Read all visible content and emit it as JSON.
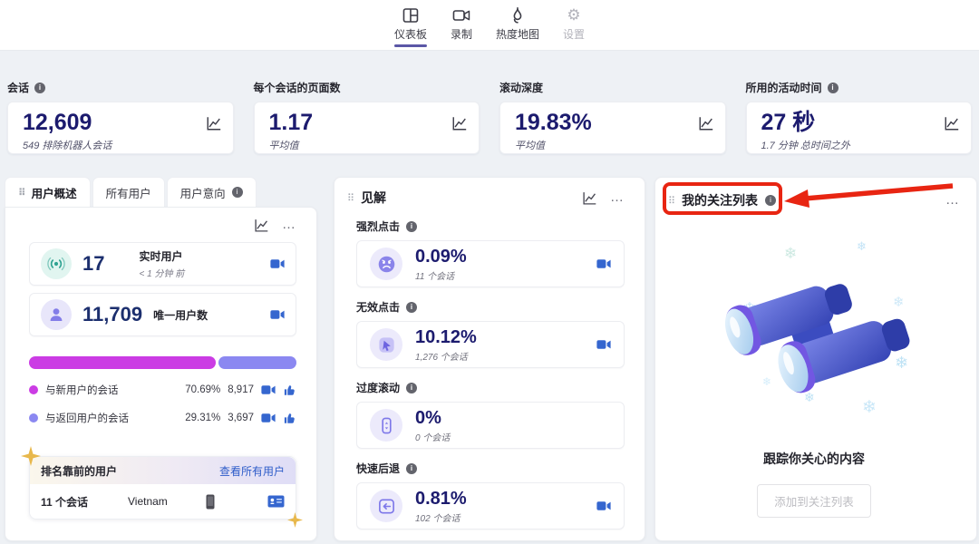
{
  "nav": {
    "items": [
      {
        "label": "仪表板",
        "icon": "dashboard-icon",
        "active": true
      },
      {
        "label": "录制",
        "icon": "recordings-icon",
        "active": false
      },
      {
        "label": "热度地图",
        "icon": "heatmap-icon",
        "active": false
      },
      {
        "label": "设置",
        "icon": "settings-icon",
        "active": false
      }
    ]
  },
  "metrics": {
    "cards": [
      {
        "label": "会话",
        "value": "12,609",
        "subtitle": "549 排除机器人会话"
      },
      {
        "label": "每个会话的页面数",
        "value": "1.17",
        "subtitle": "平均值"
      },
      {
        "label": "滚动深度",
        "value": "19.83%",
        "subtitle": "平均值"
      },
      {
        "label": "所用的活动时间",
        "value": "27 秒",
        "subtitle": "1.7 分钟 总时间之外"
      }
    ]
  },
  "users_panel": {
    "tabs": [
      {
        "label": "用户概述"
      },
      {
        "label": "所有用户"
      },
      {
        "label": "用户意向"
      }
    ],
    "live": {
      "value": "17",
      "label": "实时用户",
      "sub": "< 1 分钟 前"
    },
    "unique": {
      "value": "11,709",
      "label": "唯一用户数"
    },
    "split_bar": {
      "new_pct": 70.69,
      "returning_pct": 29.31,
      "new_color": "#cb3ce4",
      "returning_color": "#8b88f1"
    },
    "legend": [
      {
        "label": "与新用户的会话",
        "pct": "70.69%",
        "count": "8,917"
      },
      {
        "label": "与返回用户的会话",
        "pct": "29.31%",
        "count": "3,697"
      }
    ],
    "top_users": {
      "title": "排名靠前的用户",
      "link": "查看所有用户",
      "row": {
        "sessions": "11 个会话",
        "country": "Vietnam"
      }
    }
  },
  "insights_panel": {
    "title": "见解",
    "sections": [
      {
        "label": "强烈点击",
        "value": "0.09%",
        "sessions": "11 个会话"
      },
      {
        "label": "无效点击",
        "value": "10.12%",
        "sessions": "1,276 个会话"
      },
      {
        "label": "过度滚动",
        "value": "0%",
        "sessions": "0 个会话"
      },
      {
        "label": "快速后退",
        "value": "0.81%",
        "sessions": "102 个会话"
      }
    ]
  },
  "watchlist_panel": {
    "title": "我的关注列表",
    "empty_title": "跟踪你关心的内容",
    "add_button": "添加到关注列表"
  },
  "icons": {
    "more": "…",
    "drag": "⠿",
    "gear": "⚙",
    "snowflake": "❄"
  },
  "colors": {
    "accent_blue": "#3566cf",
    "navy_value": "#1c1b6e",
    "annotation_red": "#e82512"
  }
}
